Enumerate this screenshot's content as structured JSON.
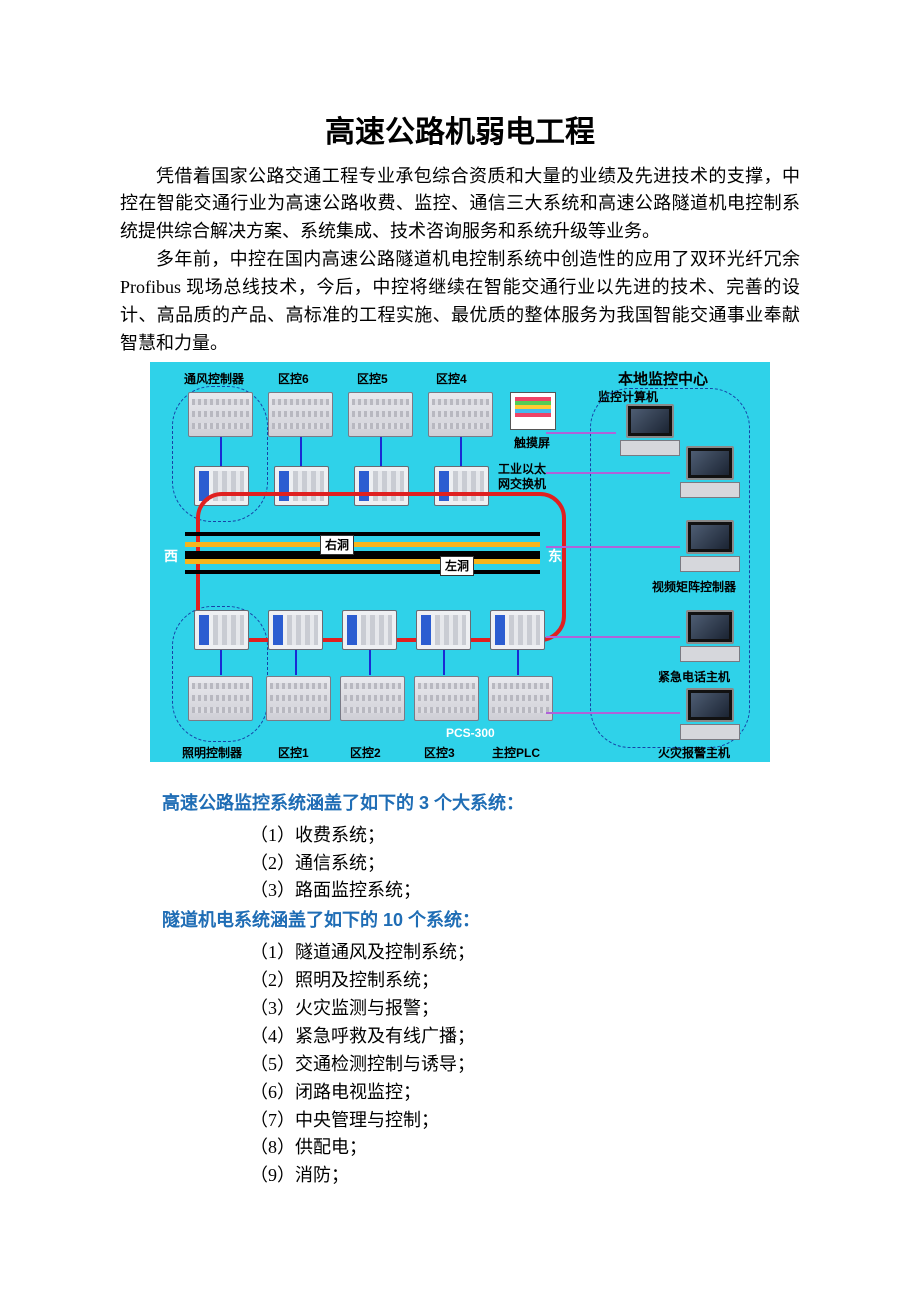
{
  "title": "高速公路机弱电工程",
  "para1": "凭借着国家公路交通工程专业承包综合资质和大量的业绩及先进技术的支撑，中控在智能交通行业为高速公路收费、监控、通信三大系统和高速公路隧道机电控制系统提供综合解决方案、系统集成、技术咨询服务和系统升级等业务。",
  "para2": "多年前，中控在国内高速公路隧道机电控制系统中创造性的应用了双环光纤冗余 Profibus 现场总线技术，今后，中控将继续在智能交通行业以先进的技术、完善的设计、高品质的产品、高标准的工程实施、最优质的整体服务为我国智能交通事业奉献智慧和力量。",
  "diagram": {
    "top_labels": [
      "通风控制器",
      "区控6",
      "区控5",
      "区控4"
    ],
    "right_title": "本地监控中心",
    "touch_label": "触摸屏",
    "eth_label_l1": "工业以太",
    "eth_label_l2": "网交换机",
    "right_labels": [
      "监控计算机",
      "视频矩阵控制器",
      "紧急电话主机",
      "火灾报警主机"
    ],
    "west": "西",
    "east": "东",
    "tunnel_r": "右洞",
    "tunnel_l": "左洞",
    "bottom_labels": [
      "照明控制器",
      "区控1",
      "区控2",
      "区控3",
      "主控PLC"
    ],
    "pcs": "PCS-300"
  },
  "sec1_title": "高速公路监控系统涵盖了如下的 3 个大系统：",
  "sec1_items": [
    "（1）收费系统；",
    "（2）通信系统；",
    "（3）路面监控系统；"
  ],
  "sec2_title": "隧道机电系统涵盖了如下的 10 个系统：",
  "sec2_items": [
    "（1）隧道通风及控制系统；",
    "（2）照明及控制系统；",
    "（3）火灾监测与报警；",
    "（4）紧急呼救及有线广播；",
    "（5）交通检测控制与诱导；",
    "（6）闭路电视监控；",
    "（7）中央管理与控制；",
    "（8）供配电；",
    "（9）消防；"
  ]
}
